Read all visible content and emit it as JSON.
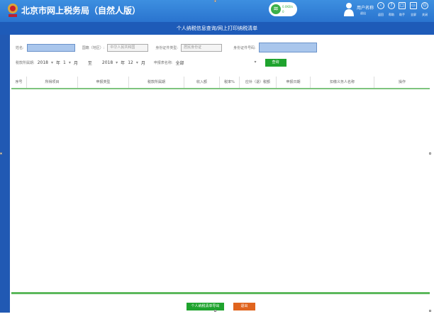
{
  "header": {
    "site_title": "北京市网上税务局（自然人版）",
    "network": {
      "line1": "0.0KB/s",
      "line2": "0"
    },
    "user_name": "用户名称",
    "logout": "退出",
    "tools": [
      {
        "icon": "back-icon",
        "label": "返回",
        "glyph": "‹"
      },
      {
        "icon": "help-icon",
        "label": "帮助",
        "glyph": "?"
      },
      {
        "icon": "assistant-icon",
        "label": "助手",
        "glyph": "□"
      },
      {
        "icon": "fullscreen-icon",
        "label": "全屏",
        "glyph": "▭"
      },
      {
        "icon": "power-icon",
        "label": "关闭",
        "glyph": "⏻"
      }
    ]
  },
  "page_title": "个人纳税信息查询/网上打印纳税清单",
  "form": {
    "name_label": "姓名:",
    "name_value": "",
    "nationality_label": "国籍（地区）:",
    "nationality_value": "中华人民共和国",
    "id_type_label": "身份证件类型:",
    "id_type_value": "居民身份证",
    "id_no_label": "身份证件号码:",
    "id_no_value": "",
    "period_label": "税款所属期:",
    "start_year": "2018",
    "year_unit": "年",
    "start_month": "1",
    "month_unit": "月",
    "to": "至",
    "end_year": "2018",
    "end_month": "12",
    "report_label": "申报表名称:",
    "report_value": "全部",
    "query": "查询"
  },
  "table": {
    "columns": [
      "序号",
      "所得项目",
      "申报类型",
      "税款所属期",
      "收入额",
      "税率%",
      "应补（退）税额",
      "申报日期",
      "扣缴义务人名称",
      "操作"
    ],
    "rows": []
  },
  "footer": {
    "export": "个人纳税清单导出",
    "exit": "退出"
  },
  "colors": {
    "green": "#1fa32e",
    "orange": "#e0641e",
    "blue": "#1e5bb8"
  }
}
